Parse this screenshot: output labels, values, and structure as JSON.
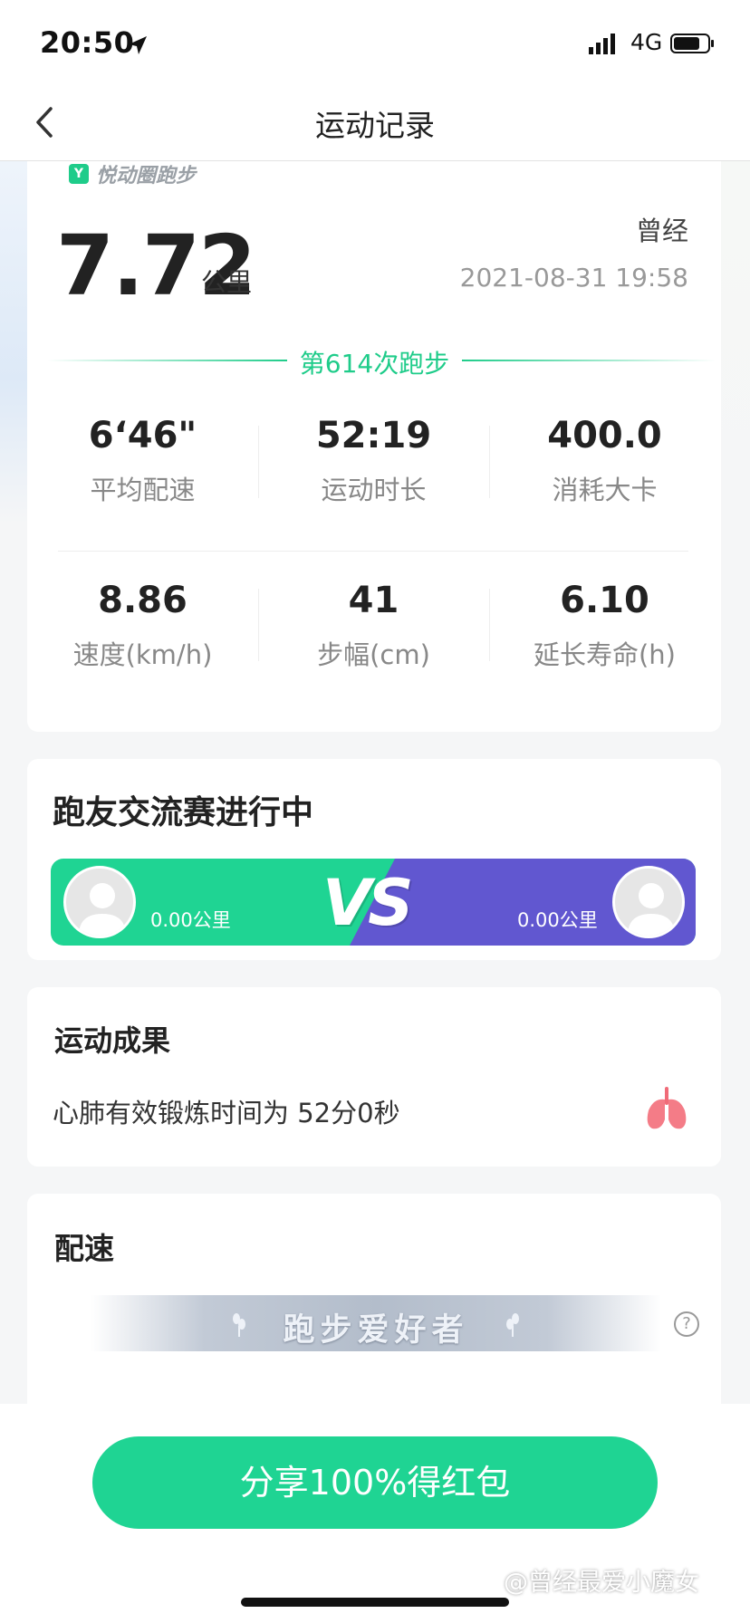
{
  "status_bar": {
    "time": "20:50",
    "network": "4G"
  },
  "nav": {
    "title": "运动记录"
  },
  "brand": {
    "logo_glyph": "Y",
    "name": "悦动圈跑步"
  },
  "summary": {
    "distance": "7.72",
    "distance_unit": "公里",
    "username": "曾经",
    "datetime": "2021-08-31 19:58",
    "run_count": "第614次跑步"
  },
  "stats": [
    {
      "value": "6‘46\"",
      "label": "平均配速"
    },
    {
      "value": "52:19",
      "label": "运动时长"
    },
    {
      "value": "400.0",
      "label": "消耗大卡"
    },
    {
      "value": "8.86",
      "label": "速度(km/h)"
    },
    {
      "value": "41",
      "label": "步幅(cm)"
    },
    {
      "value": "6.10",
      "label": "延长寿命(h)"
    }
  ],
  "race": {
    "title": "跑友交流赛进行中",
    "left_km": "0.00公里",
    "right_km": "0.00公里",
    "vs": "VS",
    "colors": {
      "left": "#1fd493",
      "right": "#6157d0"
    }
  },
  "achievement": {
    "title": "运动成果",
    "text": "心肺有效锻炼时间为 52分0秒"
  },
  "pace": {
    "title": "配速",
    "badge": "跑步爱好者",
    "help": "?"
  },
  "share_button": "分享100%得红包",
  "watermark": "@曾经最爱小魔女",
  "colors": {
    "accent": "#1fcc8a"
  }
}
